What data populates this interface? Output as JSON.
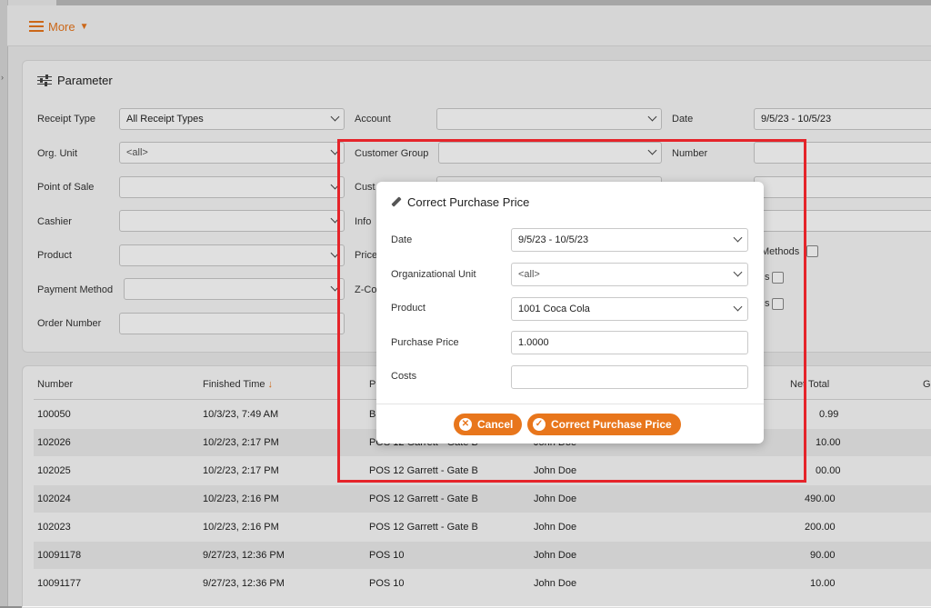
{
  "toolbar": {
    "more_label": "More"
  },
  "parameter": {
    "title": "Parameter",
    "labels": {
      "receipt_type": "Receipt Type",
      "org_unit": "Org. Unit",
      "point_of_sale": "Point of Sale",
      "cashier": "Cashier",
      "product": "Product",
      "payment_method": "Payment Method",
      "order_number": "Order Number",
      "account": "Account",
      "customer_group": "Customer Group",
      "customer_partial": "Cust",
      "info_partial": "Info",
      "price_partial": "Price",
      "zco_partial": "Z-Co",
      "date": "Date",
      "number": "Number",
      "methods_partial": "Methods",
      "s1_partial": "s",
      "s2_partial": "s"
    },
    "values": {
      "receipt_type": "All Receipt Types",
      "org_unit": "<all>",
      "date": "9/5/23 - 10/5/23"
    }
  },
  "table": {
    "columns": {
      "number": "Number",
      "finished_time": "Finished Time",
      "pos_partial": "P",
      "net_total_partial": "Net Total",
      "g_partial": "G"
    },
    "rows": [
      {
        "number": "100050",
        "time": "10/3/23, 7:49 AM",
        "pos": "B",
        "cashier": "",
        "net": "0.99"
      },
      {
        "number": "102026",
        "time": "10/2/23, 2:17 PM",
        "pos": "POS 12 Garrett - Gate B",
        "cashier": "John Doe",
        "net": "10.00"
      },
      {
        "number": "102025",
        "time": "10/2/23, 2:17 PM",
        "pos": "POS 12 Garrett - Gate B",
        "cashier": "John Doe",
        "net": "00.00"
      },
      {
        "number": "102024",
        "time": "10/2/23, 2:16 PM",
        "pos": "POS 12 Garrett - Gate B",
        "cashier": "John Doe",
        "net": "490.00"
      },
      {
        "number": "102023",
        "time": "10/2/23, 2:16 PM",
        "pos": "POS 12 Garrett - Gate B",
        "cashier": "John Doe",
        "net": "200.00"
      },
      {
        "number": "10091178",
        "time": "9/27/23, 12:36 PM",
        "pos": "POS 10",
        "cashier": "John Doe",
        "net": "90.00"
      },
      {
        "number": "10091177",
        "time": "9/27/23, 12:36 PM",
        "pos": "POS 10",
        "cashier": "John Doe",
        "net": "10.00"
      }
    ]
  },
  "modal": {
    "title": "Correct Purchase Price",
    "labels": {
      "date": "Date",
      "org_unit": "Organizational Unit",
      "product": "Product",
      "purchase_price": "Purchase Price",
      "costs": "Costs"
    },
    "values": {
      "date": "9/5/23 - 10/5/23",
      "org_unit": "<all>",
      "product": "1001 Coca Cola",
      "purchase_price": "1.0000",
      "costs": ""
    },
    "buttons": {
      "cancel": "Cancel",
      "confirm": "Correct Purchase Price"
    }
  },
  "colors": {
    "accent": "#e8761c",
    "highlight": "#e5242a"
  }
}
